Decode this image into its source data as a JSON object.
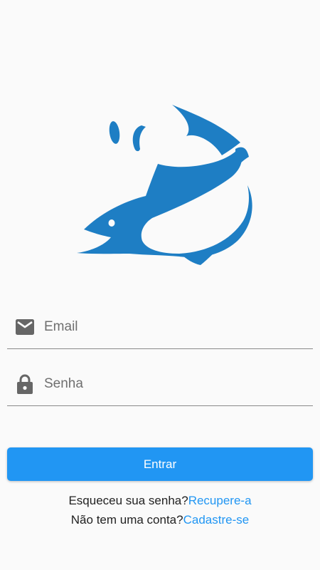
{
  "colors": {
    "accent": "#2196f3",
    "logo": "#1e7ec4",
    "background": "#fafafa"
  },
  "logo": {
    "icon": "fish-icon"
  },
  "form": {
    "email": {
      "icon": "mail-icon",
      "placeholder": "Email",
      "value": ""
    },
    "password": {
      "icon": "lock-icon",
      "placeholder": "Senha",
      "value": ""
    }
  },
  "actions": {
    "login_label": "Entrar"
  },
  "links": {
    "forgot_text": "Esqueceu sua senha?",
    "forgot_link": "Recupere-a",
    "signup_text": "Não tem uma conta?",
    "signup_link": "Cadastre-se"
  }
}
